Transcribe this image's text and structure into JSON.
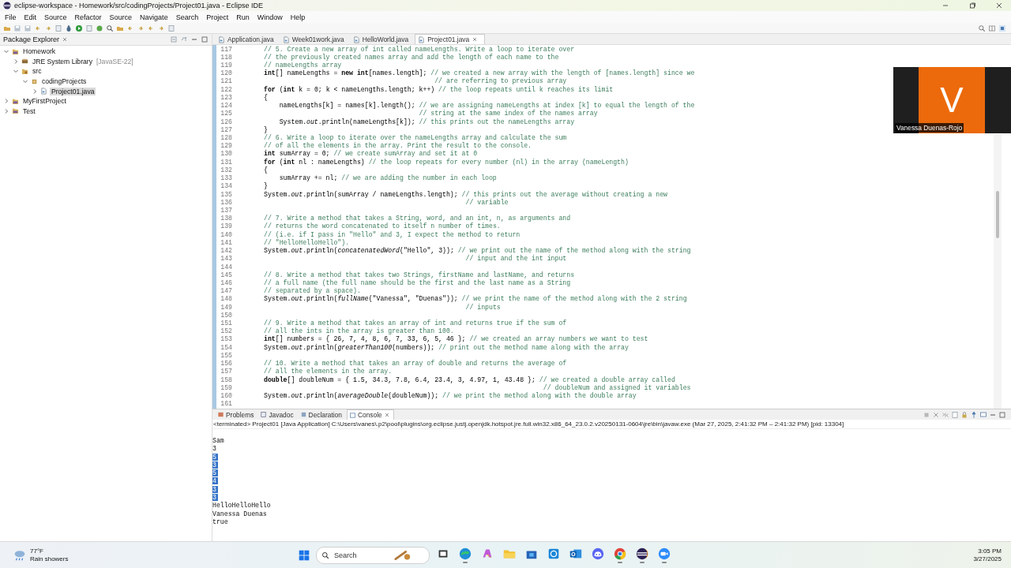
{
  "window": {
    "title": "eclipse-workspace - Homework/src/codingProjects/Project01.java - Eclipse IDE"
  },
  "menu": [
    "File",
    "Edit",
    "Source",
    "Refactor",
    "Source",
    "Navigate",
    "Search",
    "Project",
    "Run",
    "Window",
    "Help"
  ],
  "package_explorer": {
    "title": "Package Explorer",
    "tree": [
      {
        "label": "Homework",
        "kind": "project",
        "expanded": true,
        "selected": false,
        "children": [
          {
            "label": "JRE System Library",
            "decoration": "[JavaSE-22]",
            "kind": "library",
            "expanded": false,
            "selected": false
          },
          {
            "label": "src",
            "kind": "folder",
            "expanded": true,
            "selected": false,
            "children": [
              {
                "label": "codingProjects",
                "kind": "package",
                "expanded": true,
                "selected": false,
                "children": [
                  {
                    "label": "Project01.java",
                    "kind": "file",
                    "expanded": false,
                    "selected": true
                  }
                ]
              }
            ]
          }
        ]
      },
      {
        "label": "MyFirstProject",
        "kind": "project",
        "expanded": false,
        "selected": false
      },
      {
        "label": "Test",
        "kind": "project",
        "expanded": false,
        "selected": false
      }
    ]
  },
  "editor": {
    "tabs": [
      {
        "label": "Application.java",
        "selected": false
      },
      {
        "label": "Week01work.java",
        "selected": false
      },
      {
        "label": "HelloWorld.java",
        "selected": false
      },
      {
        "label": "Project01.java",
        "selected": true
      }
    ],
    "lines": [
      {
        "number": "117",
        "comment": "// 5. Create a new array of int called nameLengths. Write a loop to iterate over"
      },
      {
        "number": "118",
        "comment": "// the previously created names array and add the length of each name to the"
      },
      {
        "number": "119",
        "comment": "// nameLengths array"
      },
      {
        "number": "120",
        "code": "**int**[] nameLengths = **new** **int**[names.length];",
        "comment": "// we created a new array with the length of [names.length] since we"
      },
      {
        "number": "121",
        "comment": "                                            // are referring to previous array"
      },
      {
        "number": "122",
        "code": "**for** (**int** k = 0; k < nameLengths.length; k++)",
        "comment": "// the loop repeats until k reaches its limit"
      },
      {
        "number": "123",
        "code": "{"
      },
      {
        "number": "124",
        "code": "    nameLengths[k] = names[k].length();",
        "comment": "// we are assigning nameLengths at index [k] to equal the length of the"
      },
      {
        "number": "125",
        "comment": "                                        // string at the same index of the names array"
      },
      {
        "number": "126",
        "code": "    System.*out*.println(nameLengths[k]);",
        "comment": "// this prints out the nameLengths array"
      },
      {
        "number": "127",
        "code": "}"
      },
      {
        "number": "128",
        "comment": "// 6. Write a loop to iterate over the nameLengths array and calculate the sum"
      },
      {
        "number": "129",
        "comment": "// of all the elements in the array. Print the result to the console."
      },
      {
        "number": "130",
        "code": "**int** sumArray = 0;",
        "comment": "// we create sumArray and set it at 0"
      },
      {
        "number": "131",
        "code": "**for** (**int** nl : nameLengths)",
        "comment": "// the loop repeats for every number (nl) in the array (nameLength)"
      },
      {
        "number": "132",
        "code": "{"
      },
      {
        "number": "133",
        "code": "    sumArray += nl;",
        "comment": "// we are adding the number in each loop"
      },
      {
        "number": "134",
        "code": "}"
      },
      {
        "number": "135",
        "code": "System.*out*.println(sumArray / nameLengths.length);",
        "comment": "// this prints out the average without creating a new"
      },
      {
        "number": "136",
        "comment": "                                                    // variable"
      },
      {
        "number": "137"
      },
      {
        "number": "138",
        "comment": "// 7. Write a method that takes a String, word, and an int, n, as arguments and"
      },
      {
        "number": "139",
        "comment": "// returns the word concatenated to itself n number of times."
      },
      {
        "number": "140",
        "comment": "// (i.e. if I pass in \"Hello\" and 3, I expect the method to return"
      },
      {
        "number": "141",
        "comment": "// \"HelloHelloHello\")."
      },
      {
        "number": "142",
        "code": "System.*out*.println(*concatenatedWord*(\"Hello\", 3));",
        "comment": "// we print out the name of the method along with the string"
      },
      {
        "number": "143",
        "comment": "                                                    // input and the int input"
      },
      {
        "number": "144"
      },
      {
        "number": "145",
        "comment": "// 8. Write a method that takes two Strings, firstName and lastName, and returns"
      },
      {
        "number": "146",
        "comment": "// a full name (the full name should be the first and the last name as a String"
      },
      {
        "number": "147",
        "comment": "// separated by a space)."
      },
      {
        "number": "148",
        "code": "System.*out*.println(*fullName*(\"Vanessa\", \"Duenas\"));",
        "comment": "// we print the name of the method along with the 2 string"
      },
      {
        "number": "149",
        "comment": "                                                    // inputs"
      },
      {
        "number": "150"
      },
      {
        "number": "151",
        "comment": "// 9. Write a method that takes an array of int and returns true if the sum of"
      },
      {
        "number": "152",
        "comment": "// all the ints in the array is greater than 100."
      },
      {
        "number": "153",
        "code": "**int**[] numbers = { 26, 7, 4, 8, 6, 7, 33, 6, 5, 46 };",
        "comment": "// we created an array numbers we want to test"
      },
      {
        "number": "154",
        "code": "System.*out*.println(*greaterThan100*(numbers));",
        "comment": "// print out the method name along with the array"
      },
      {
        "number": "155"
      },
      {
        "number": "156",
        "comment": "// 10. Write a method that takes an array of double and returns the average of"
      },
      {
        "number": "157",
        "comment": "// all the elements in the array."
      },
      {
        "number": "158",
        "code": "**double**[] doubleNum = { 1.5, 34.3, 7.8, 6.4, 23.4, 3, 4.97, 1, 43.48 };",
        "comment": "// we created a double array called"
      },
      {
        "number": "159",
        "comment": "                                                                        // doubleNum and assigned it variables"
      },
      {
        "number": "160",
        "code": "System.*out*.println(*averageDouble*(doubleNum));",
        "comment": "// we print the method along with the double array"
      },
      {
        "number": "161"
      }
    ]
  },
  "console": {
    "tabs": [
      {
        "label": "Problems",
        "kind": "problems",
        "selected": false
      },
      {
        "label": "Javadoc",
        "kind": "javadoc",
        "selected": false
      },
      {
        "label": "Declaration",
        "kind": "declaration",
        "selected": false
      },
      {
        "label": "Console",
        "kind": "console",
        "selected": true
      }
    ],
    "status": "<terminated> Project01 [Java Application] C:\\Users\\vanes\\.p2\\pool\\plugins\\org.eclipse.justj.openjdk.hotspot.jre.full.win32.x86_64_23.0.2.v20250131-0604\\jre\\bin\\javaw.exe  (Mar 27, 2025, 2:41:32 PM – 2:41:32 PM) [pid: 13304]",
    "output": [
      {
        "text": "Sam",
        "selected": false
      },
      {
        "text": "3",
        "selected": false
      },
      {
        "text": "5",
        "selected": true
      },
      {
        "text": "3",
        "selected": true
      },
      {
        "text": "5",
        "selected": true
      },
      {
        "text": "4",
        "selected": true
      },
      {
        "text": "3",
        "selected": true
      },
      {
        "text": "3",
        "selected": true
      },
      {
        "text": "HelloHelloHello",
        "selected": false
      },
      {
        "text": "Vanessa Duenas",
        "selected": false
      },
      {
        "text": "true",
        "selected": false
      }
    ]
  },
  "video_tile": {
    "initial": "V",
    "name": "Vanessa Duenas-Rojo"
  },
  "taskbar": {
    "weather": {
      "temperature": "77°F",
      "condition": "Rain showers"
    },
    "search": {
      "placeholder": "Search"
    },
    "apps": [
      {
        "kind": "taskview",
        "running": false
      },
      {
        "kind": "edge",
        "running": true
      },
      {
        "kind": "copilot",
        "running": false
      },
      {
        "kind": "folder",
        "running": false
      },
      {
        "kind": "store",
        "running": false
      },
      {
        "kind": "bluesquare",
        "running": false
      },
      {
        "kind": "outlook",
        "running": false
      },
      {
        "kind": "discord",
        "running": false
      },
      {
        "kind": "chrome",
        "running": true
      },
      {
        "kind": "eclipse",
        "running": true
      },
      {
        "kind": "zoom",
        "running": true
      }
    ],
    "time": "3:05 PM",
    "date": "3/27/2025"
  }
}
